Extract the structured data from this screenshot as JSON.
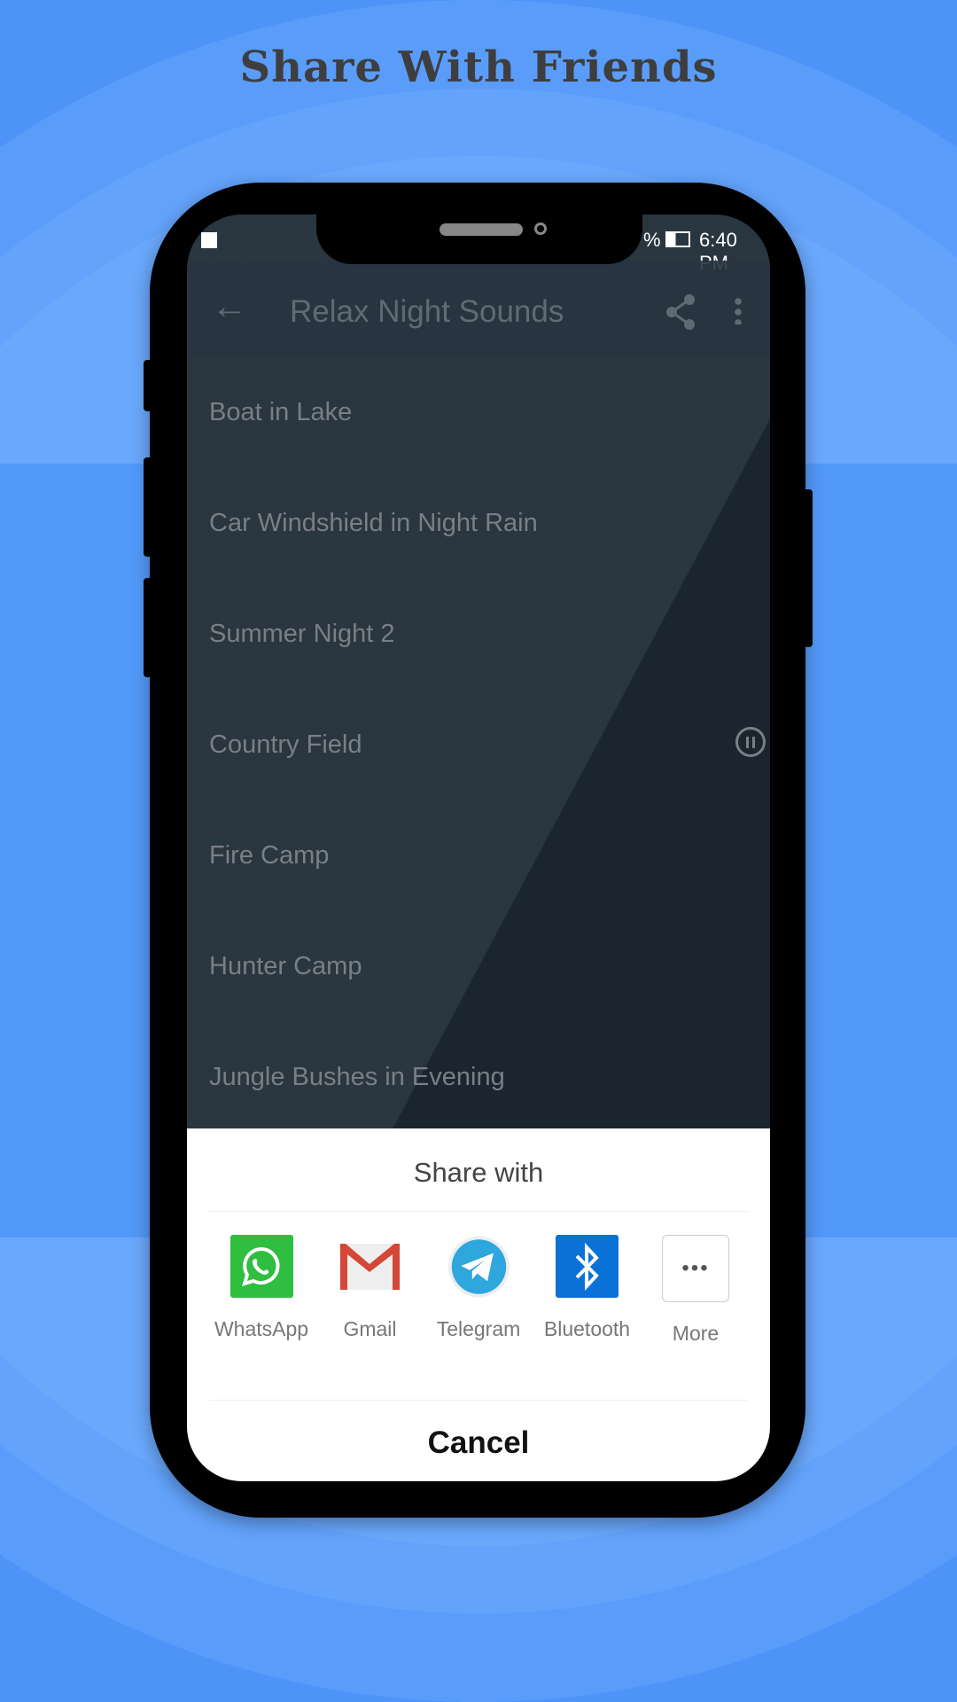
{
  "headline": "Share With Friends",
  "status": {
    "battery": "%",
    "time": "6:40 PM"
  },
  "toolbar": {
    "title": "Relax Night Sounds"
  },
  "sounds": [
    "Boat in Lake",
    "Car Windshield in Night Rain",
    "Summer Night 2",
    "Country Field",
    "Fire Camp",
    "Hunter Camp",
    "Jungle Bushes in Evening"
  ],
  "playing_index": 3,
  "share": {
    "title": "Share with",
    "apps": [
      {
        "label": "WhatsApp",
        "icon": "whatsapp-icon",
        "color": "#2fbe3f"
      },
      {
        "label": "Gmail",
        "icon": "gmail-icon",
        "color": "#d44638"
      },
      {
        "label": "Telegram",
        "icon": "telegram-icon",
        "color": "#2ea6de"
      },
      {
        "label": "Bluetooth",
        "icon": "bluetooth-icon",
        "color": "#0a72d6"
      },
      {
        "label": "More",
        "icon": "more-icon",
        "color": "#ffffff"
      }
    ],
    "cancel": "Cancel"
  },
  "colors": {
    "background": "#4d93f8"
  }
}
